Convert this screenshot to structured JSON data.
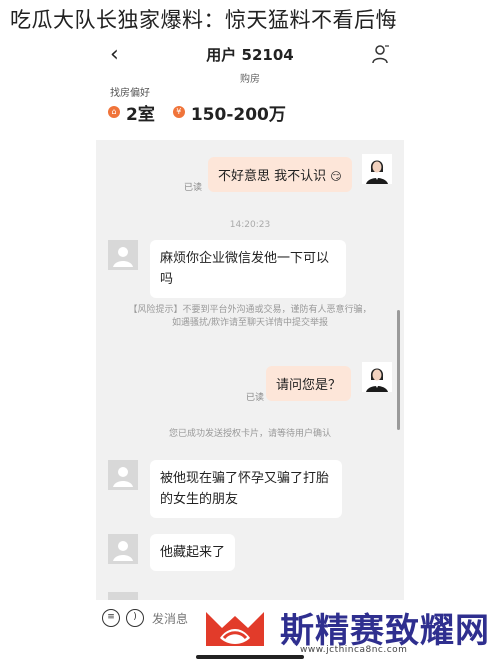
{
  "headline": "吃瓜大队长独家爆料：惊天猛料不看后悔",
  "nav": {
    "back_icon": "chevron-left-icon",
    "title": "用户 52104",
    "user_icon": "user-icon"
  },
  "subtitle": "购房",
  "preferences": {
    "label": "找房偏好",
    "items": [
      {
        "icon": "house-icon",
        "value": "2室"
      },
      {
        "icon": "money-icon",
        "value": "150-200万"
      }
    ]
  },
  "chat": {
    "messages": [
      {
        "side": "right",
        "text": "不好意思 我不认识",
        "status": "已读"
      },
      {
        "type": "time",
        "text": "14:20:23"
      },
      {
        "side": "left",
        "text": "麻烦你企业微信发他一下可以吗"
      },
      {
        "type": "system",
        "text": "【风险提示】不要到平台外沟通或交易，谨防有人恶意行骗，如遇骚扰/欺诈请至聊天详情中提交举报"
      },
      {
        "side": "right",
        "text": "请问您是？",
        "status": "已读"
      },
      {
        "type": "system",
        "text": "您已成功发送授权卡片，请等待用户确认"
      },
      {
        "side": "left",
        "text": "被他现在骗了怀孕又骗了打胎的女生的朋友"
      },
      {
        "side": "left",
        "text": "他藏起来了"
      }
    ]
  },
  "inputbar": {
    "icons": [
      "list-icon",
      "voice-icon"
    ],
    "placeholder": "发消息"
  },
  "watermark": {
    "brand": "斯精赛致耀网",
    "url": "www.jcthinca8nc.com"
  },
  "colors": {
    "accent": "#f0743a",
    "bubble_right": "#fde6d9",
    "chat_bg": "#f1f1f1",
    "brand": "#2f2f8f",
    "logo_red": "#e23b2a"
  }
}
